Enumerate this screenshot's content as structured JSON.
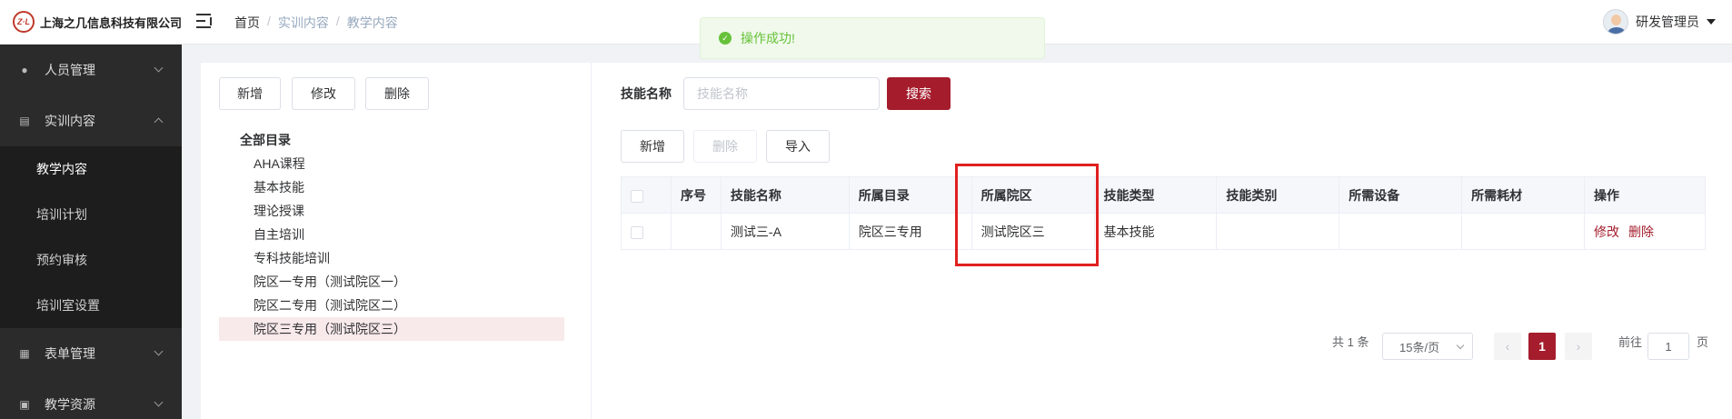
{
  "header": {
    "logo_mark": "Z·L",
    "company": "上海之几信息科技有限公司",
    "breadcrumb": [
      "首页",
      "实训内容",
      "教学内容"
    ],
    "breadcrumb_sep": "/",
    "user_name": "研发管理员"
  },
  "toast": {
    "message": "操作成功!"
  },
  "sidebar": {
    "items": [
      {
        "label": "人员管理",
        "icon": "user-icon"
      },
      {
        "label": "实训内容",
        "icon": "book-icon",
        "expanded": true
      },
      {
        "label": "表单管理",
        "icon": "form-icon"
      },
      {
        "label": "教学资源",
        "icon": "resource-icon"
      }
    ],
    "sub_items": [
      "教学内容",
      "培训计划",
      "预约审核",
      "培训室设置"
    ]
  },
  "left_toolbar": {
    "add": "新增",
    "edit": "修改",
    "delete": "删除"
  },
  "tree": {
    "root": "全部目录",
    "children": [
      "AHA课程",
      "基本技能",
      "理论授课",
      "自主培训",
      "专科技能培训",
      "院区一专用（测试院区一）",
      "院区二专用（测试院区二）",
      "院区三专用（测试院区三）"
    ],
    "selected": "院区三专用（测试院区三）"
  },
  "search": {
    "label": "技能名称",
    "placeholder": "技能名称",
    "button": "搜索"
  },
  "right_toolbar": {
    "add": "新增",
    "delete": "删除",
    "import": "导入"
  },
  "table": {
    "headers": [
      "序号",
      "技能名称",
      "所属目录",
      "所属院区",
      "技能类型",
      "技能类别",
      "所需设备",
      "所需耗材",
      "操作"
    ],
    "rows": [
      {
        "index": "",
        "name": "测试三-A",
        "catalog": "院区三专用",
        "campus": "测试院区三",
        "type": "基本技能",
        "category": "",
        "equipment": "",
        "consumables": "",
        "edit": "修改",
        "delete": "删除"
      }
    ]
  },
  "pagination": {
    "total": "共 1 条",
    "page_size": "15条/页",
    "current": "1",
    "goto_label": "前往",
    "goto_value": "1",
    "goto_suffix": "页"
  },
  "colors": {
    "accent": "#a51d2d",
    "success": "#67c23a",
    "highlight": "#e02020"
  }
}
